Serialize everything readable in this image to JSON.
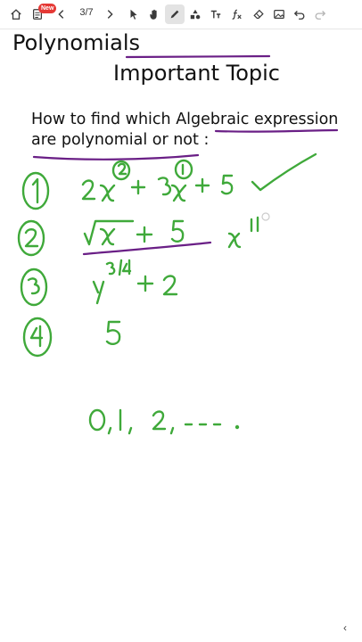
{
  "toolbar": {
    "page_indicator": "3/7",
    "new_badge": "New",
    "icons": [
      "home-icon",
      "document-icon",
      "chevron-left-icon",
      "chevron-right-icon",
      "select-arrow-icon",
      "hand-icon",
      "pen-icon",
      "shapes-icon",
      "text-icon",
      "formula-icon",
      "eraser-icon",
      "image-icon",
      "undo-icon",
      "redo-icon"
    ]
  },
  "note": {
    "title": "Polynomials",
    "subtitle": "Important Topic",
    "question_line1": "How to find which Algebraic expression",
    "question_line2": "are polynomial or not :"
  },
  "handwriting": {
    "item1": {
      "number": "1",
      "expression": "2x² + 3x¹ + 5",
      "mark": "✓"
    },
    "item2": {
      "number": "2",
      "expression": "√x + 5",
      "side_note": "x½"
    },
    "item3": {
      "number": "3",
      "expression": "y³ᐟ⁴ + 2"
    },
    "item4": {
      "number": "4",
      "expression": "5"
    },
    "sequence": "0, 1, 2, - - - ."
  },
  "colors": {
    "ink_green": "#3fa93a",
    "ink_purple": "#6a1f86",
    "typed_text": "#111111"
  }
}
